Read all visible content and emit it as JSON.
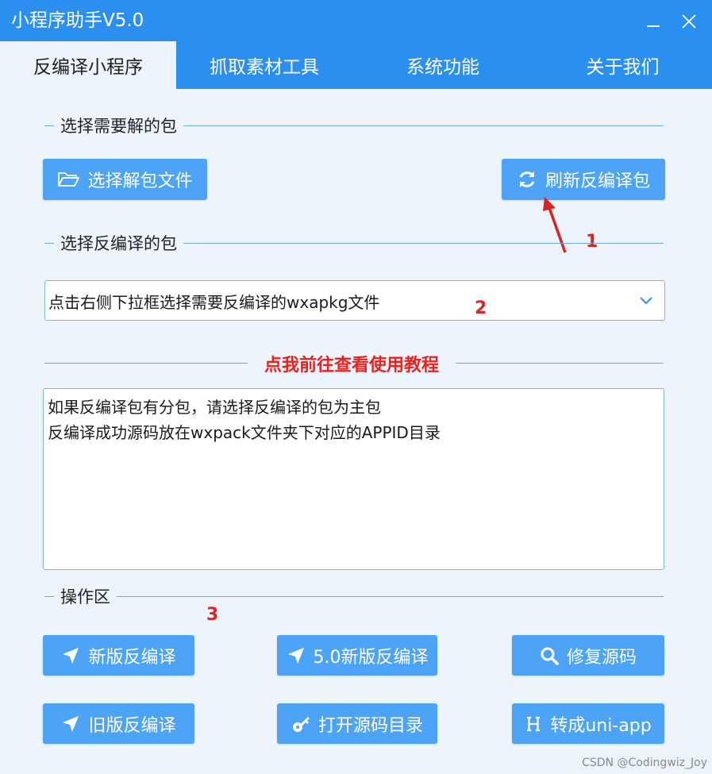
{
  "window": {
    "title": "小程序助手V5.0",
    "minimize_icon": "minimize-icon",
    "close_icon": "close-icon"
  },
  "tabs": [
    {
      "label": "反编译小程序",
      "active": true
    },
    {
      "label": "抓取素材工具",
      "active": false
    },
    {
      "label": "系统功能",
      "active": false
    },
    {
      "label": "关于我们",
      "active": false
    }
  ],
  "sections": {
    "select_package": "选择需要解的包",
    "select_decompile": "选择反编译的包",
    "operations": "操作区"
  },
  "buttons": {
    "select_unpack_file": "选择解包文件",
    "refresh_decompile": "刷新反编译包",
    "new_decompile": "新版反编译",
    "v5_new_decompile": "5.0新版反编译",
    "repair_source": "修复源码",
    "old_decompile": "旧版反编译",
    "open_source_dir": "打开源码目录",
    "to_uniapp": "转成uni-app"
  },
  "select": {
    "placeholder": "点击右侧下拉框选择需要反编译的wxapkg文件"
  },
  "tutorial_link": "点我前往查看使用教程",
  "info_text": {
    "line1": "如果反编译包有分包，请选择反编译的包为主包",
    "line2": "反编译成功源码放在wxpack文件夹下对应的APPID目录"
  },
  "annotations": {
    "marker1": "1",
    "marker2": "2",
    "marker3": "3"
  },
  "watermark": "CSDN @Codingwiz_Joy",
  "colors": {
    "accent": "#2b8ff0",
    "button": "#4da3f5",
    "background": "#eef4fc",
    "link": "#e8231f",
    "annotation": "#d82424"
  }
}
